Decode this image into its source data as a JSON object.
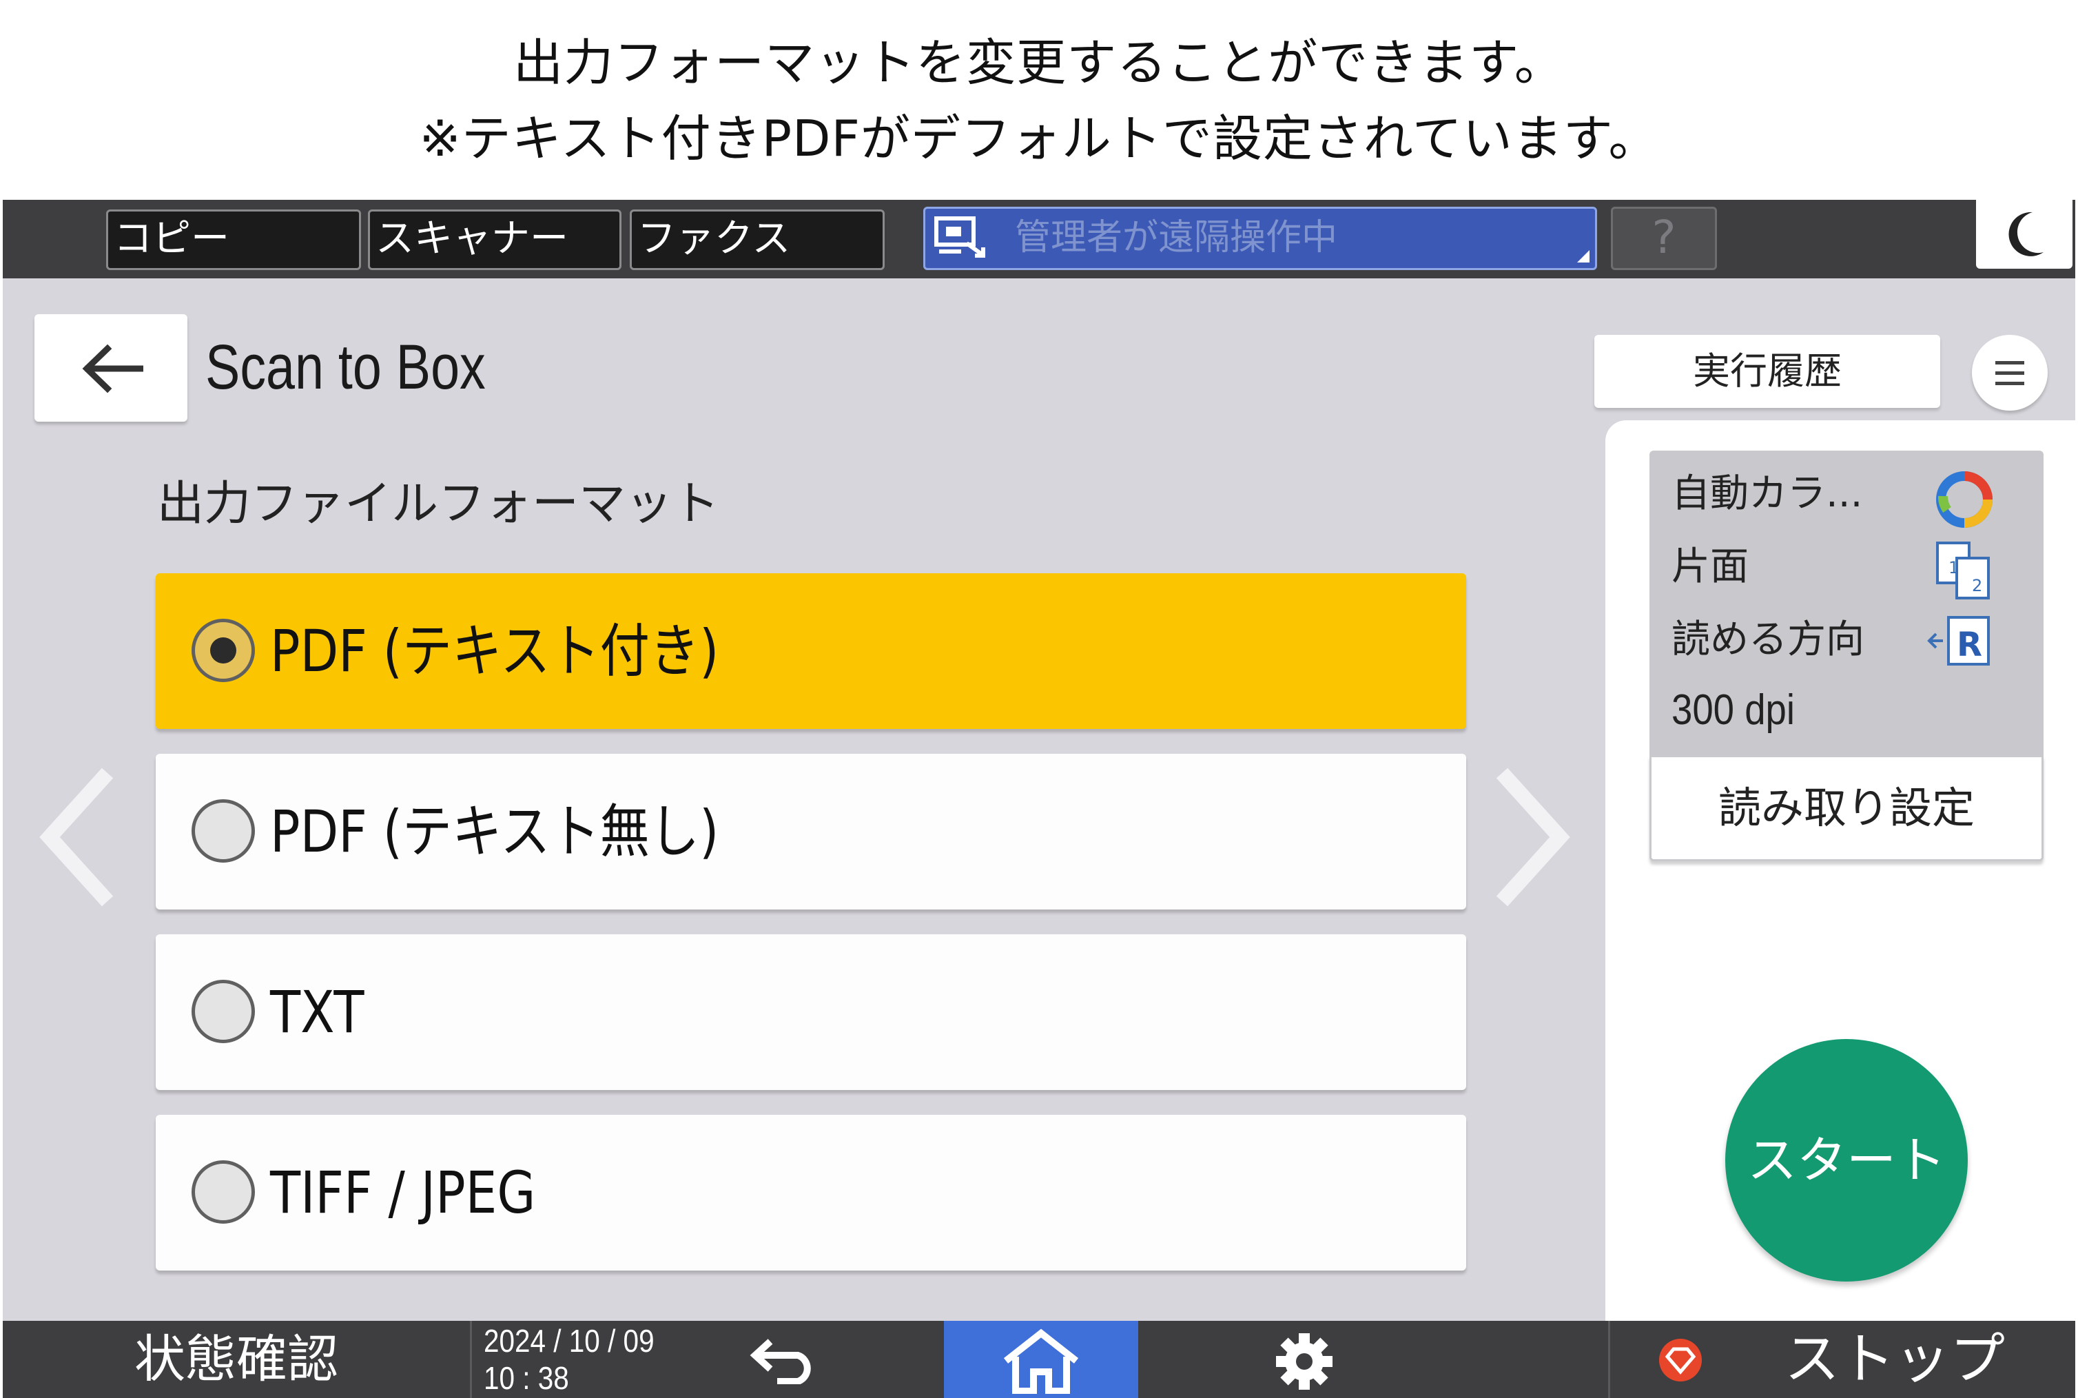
{
  "caption": {
    "line1": "出力フォーマットを変更することができます。",
    "line2": "※テキスト付きPDFがデフォルトで設定されています。"
  },
  "topbar": {
    "tabs": [
      "コピー",
      "スキャナー",
      "ファクス"
    ],
    "remote_status": "管理者が遠隔操作中",
    "help_label": "?"
  },
  "header": {
    "title": "Scan to Box",
    "history_label": "実行履歴"
  },
  "format_section": {
    "label": "出力ファイルフォーマット",
    "options": [
      {
        "label": "PDF (テキスト付き)",
        "selected": true
      },
      {
        "label": "PDF (テキスト無し)",
        "selected": false
      },
      {
        "label": "TXT",
        "selected": false
      },
      {
        "label": "TIFF / JPEG",
        "selected": false
      }
    ]
  },
  "settings_summary": {
    "color_mode": "自動カラ...",
    "sides": "片面",
    "orientation": "読める方向",
    "orientation_icon_letter": "R",
    "duplex_icon_numbers": [
      "1",
      "2"
    ],
    "resolution": "300 dpi",
    "settings_button": "読み取り設定"
  },
  "start_label": "スタート",
  "bottombar": {
    "status_label": "状態確認",
    "date": "2024 / 10 / 09",
    "time": "10 : 38",
    "stop_label": "ストップ"
  },
  "colors": {
    "selected_option": "#fbc600",
    "start_button": "#139a70",
    "home_button": "#3f6fd8",
    "remote_bar": "#3c5ab5",
    "bar_background": "#3e3e40"
  },
  "icons": [
    "monitor-remote-icon",
    "help-icon",
    "sleep-moon-icon",
    "back-arrow-icon",
    "menu-icon",
    "prev-arrow-icon",
    "next-arrow-icon",
    "auto-color-icon",
    "duplex-icon",
    "orientation-icon",
    "return-icon",
    "home-icon",
    "gear-icon",
    "stop-icon"
  ]
}
